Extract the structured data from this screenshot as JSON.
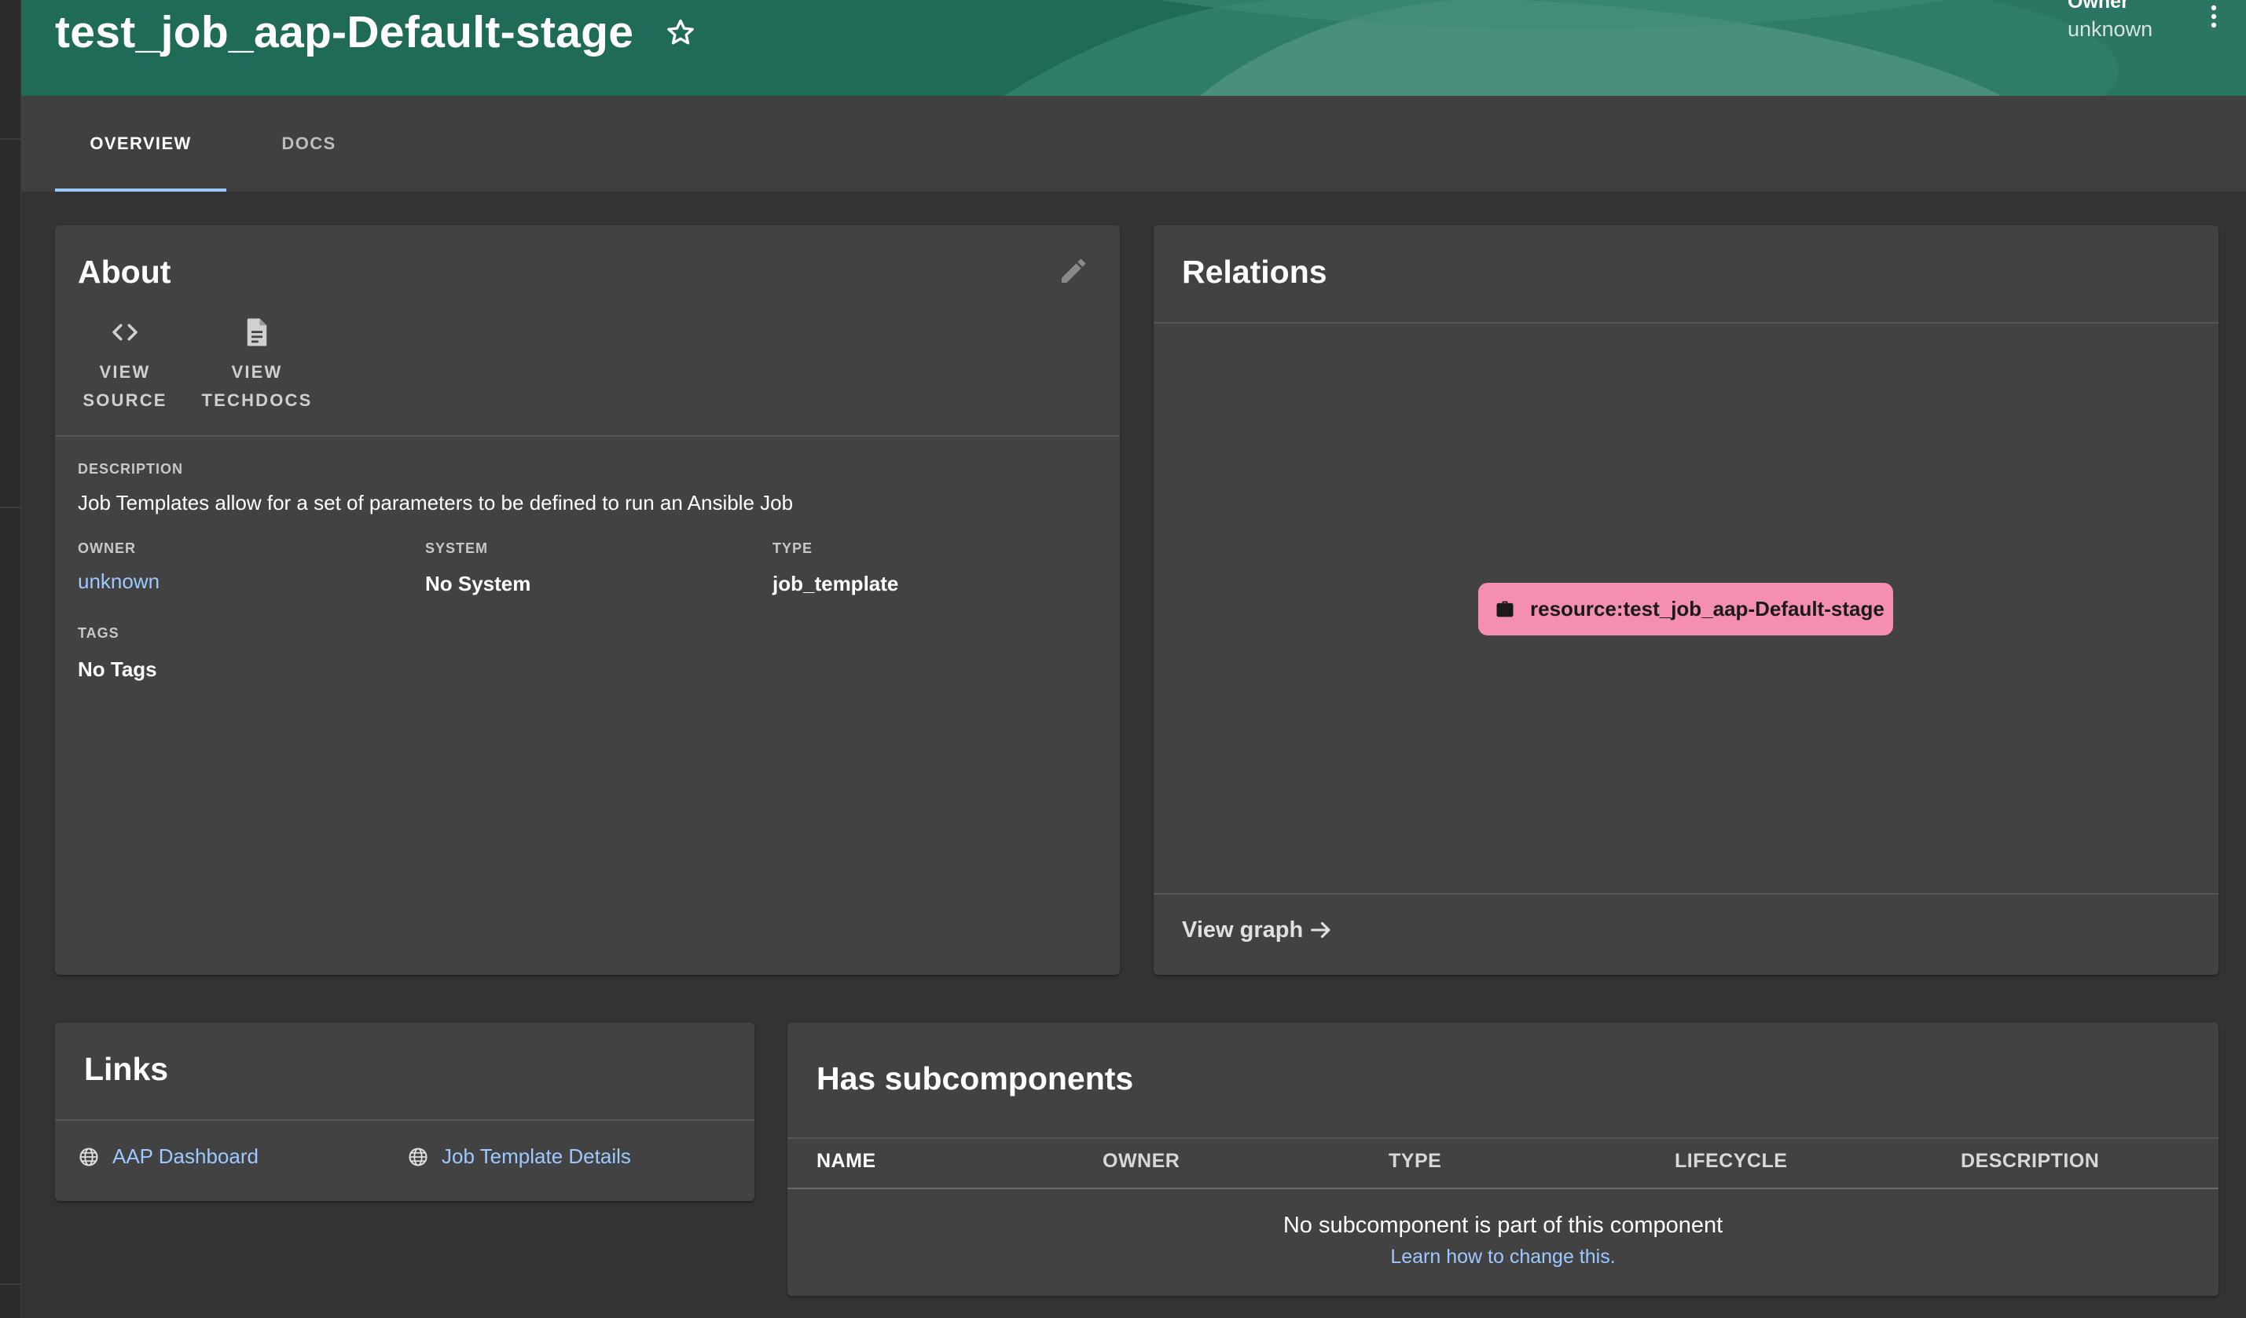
{
  "header": {
    "title": "test_job_aap-Default-stage",
    "owner_label": "Owner",
    "owner_value": "unknown",
    "star_icon": "star-outline-icon",
    "menu_icon": "more-vertical-icon"
  },
  "tabs": [
    {
      "label": "OVERVIEW",
      "selected": true
    },
    {
      "label": "DOCS",
      "selected": false
    }
  ],
  "about": {
    "title": "About",
    "view_source_line1": "VIEW",
    "view_source_line2": "SOURCE",
    "view_techdocs_line1": "VIEW",
    "view_techdocs_line2": "TECHDOCS",
    "description_label": "DESCRIPTION",
    "description": "Job Templates allow for a set of parameters to be defined to run an Ansible Job",
    "owner_label": "OWNER",
    "owner": "unknown",
    "system_label": "SYSTEM",
    "system": "No System",
    "type_label": "TYPE",
    "type": "job_template",
    "tags_label": "TAGS",
    "tags": "No Tags"
  },
  "relations": {
    "title": "Relations",
    "node_label": "resource:test_job_aap-Default-stage",
    "view_graph": "View graph"
  },
  "links": {
    "title": "Links",
    "items": [
      {
        "label": "AAP Dashboard",
        "icon": "globe-icon"
      },
      {
        "label": "Job Template Details",
        "icon": "globe-icon"
      }
    ]
  },
  "subcomponents": {
    "title": "Has subcomponents",
    "columns": [
      "NAME",
      "OWNER",
      "TYPE",
      "LIFECYCLE",
      "DESCRIPTION"
    ],
    "empty_message": "No subcomponent is part of this component",
    "learn_link": "Learn how to change this."
  },
  "colors": {
    "header_bg": "#1f6b57",
    "card_bg": "#424242",
    "link": "#9cc9ff",
    "node_pink": "#f48fb1",
    "tab_indicator": "#9cc9ff"
  }
}
